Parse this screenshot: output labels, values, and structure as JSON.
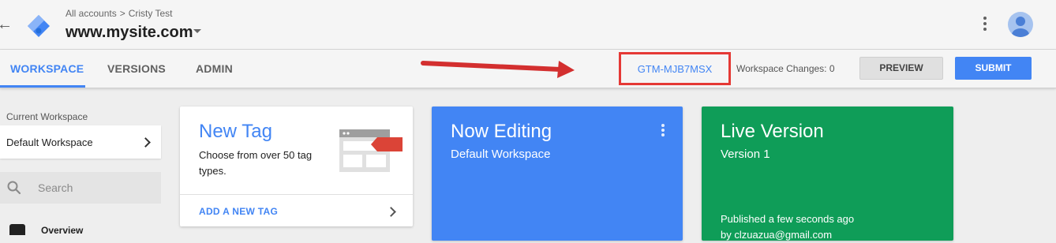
{
  "header": {
    "breadcrumb_root": "All accounts",
    "breadcrumb_sep": ">",
    "breadcrumb_account": "Cristy Test",
    "container_name": "www.mysite.com"
  },
  "tabs": [
    {
      "label": "WORKSPACE",
      "active": true
    },
    {
      "label": "VERSIONS",
      "active": false
    },
    {
      "label": "ADMIN",
      "active": false
    }
  ],
  "toolbar": {
    "container_id": "GTM-MJB7MSX",
    "workspace_changes": "Workspace Changes: 0",
    "preview_label": "PREVIEW",
    "submit_label": "SUBMIT"
  },
  "sidebar": {
    "current_workspace_caption": "Current Workspace",
    "current_workspace_name": "Default Workspace",
    "search_placeholder": "Search",
    "items": [
      {
        "label": "Overview",
        "icon": "overview-icon"
      }
    ]
  },
  "cards": {
    "new_tag": {
      "title": "New Tag",
      "description": "Choose from over 50 tag types.",
      "action_label": "ADD A NEW TAG"
    },
    "now_editing": {
      "title": "Now Editing",
      "subtitle": "Default Workspace"
    },
    "live_version": {
      "title": "Live Version",
      "subtitle": "Version 1",
      "published_line1": "Published a few seconds ago",
      "published_line2": "by clzuazua@gmail.com"
    }
  },
  "colors": {
    "accent_blue": "#4285f4",
    "live_green": "#0f9d58",
    "highlight_red": "#e53935"
  }
}
